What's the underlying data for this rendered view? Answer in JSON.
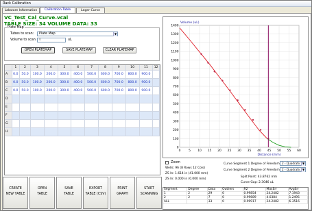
{
  "window": {
    "title": "Rack Calibration"
  },
  "tabs": [
    {
      "label": "Labware Information"
    },
    {
      "label": "Calibration Table"
    },
    {
      "label": "Lager Curve"
    }
  ],
  "file": {
    "name": "VC_Test_Cal_Curve.vcal",
    "summary": "TABLE SIZE: 34   VOLUME DATA: 33"
  },
  "platemap": {
    "group_label": "Plate Map",
    "tubes_label": "Tubes to scan:",
    "tubes_value": "Plate Map",
    "volume_label": "Volume to scan:",
    "volume_value": "0",
    "volume_unit": "uL",
    "open_label": "OPEN PLATEMAP",
    "save_label": "SAVE PLATEMAP",
    "clear_label": "CLEAR PLATEMAP"
  },
  "grid": {
    "columns": [
      "",
      "1",
      "2",
      "3",
      "4",
      "5",
      "6",
      "7",
      "8",
      "9",
      "10",
      "11",
      "12"
    ],
    "rows": [
      {
        "label": "A",
        "cells": [
          "0.0",
          "50.0",
          "100.0",
          "200.0",
          "300.0",
          "400.0",
          "500.0",
          "600.0",
          "700.0",
          "800.0",
          "900.0",
          ""
        ]
      },
      {
        "label": "B",
        "cells": [
          "0.0",
          "50.0",
          "100.0",
          "200.0",
          "300.0",
          "400.0",
          "500.0",
          "600.0",
          "700.0",
          "800.0",
          "900.0",
          ""
        ]
      },
      {
        "label": "C",
        "cells": [
          "0.0",
          "50.0",
          "100.0",
          "200.0",
          "300.0",
          "400.0",
          "500.0",
          "600.0",
          "700.0",
          "800.0",
          "900.0",
          ""
        ]
      },
      {
        "label": "D",
        "cells": [
          "",
          "",
          "",
          "",
          "",
          "",
          "",
          "",
          "",
          "",
          "",
          ""
        ]
      },
      {
        "label": "E",
        "cells": [
          "",
          "",
          "",
          "",
          "",
          "",
          "",
          "",
          "",
          "",
          "",
          ""
        ]
      },
      {
        "label": "F",
        "cells": [
          "",
          "",
          "",
          "",
          "",
          "",
          "",
          "",
          "",
          "",
          "",
          ""
        ]
      },
      {
        "label": "G",
        "cells": [
          "",
          "",
          "",
          "",
          "",
          "",
          "",
          "",
          "",
          "",
          "",
          ""
        ]
      },
      {
        "label": "H",
        "cells": [
          "",
          "",
          "",
          "",
          "",
          "",
          "",
          "",
          "",
          "",
          "",
          ""
        ]
      }
    ]
  },
  "buttons": [
    {
      "line1": "CREATE",
      "line2": "NEW TABLE"
    },
    {
      "line1": "OPEN",
      "line2": "TABLE"
    },
    {
      "line1": "SAVE",
      "line2": "TABLE"
    },
    {
      "line1": "EXPORT",
      "line2": "TABLE (CSV)"
    },
    {
      "line1": "PRINT",
      "line2": "GRAPH"
    },
    {
      "line1": "START",
      "line2": "SCANNING"
    }
  ],
  "chart_data": {
    "type": "line",
    "ylabel": "Volume (uL)",
    "xlabel": "Distance (mm)",
    "xlim": [
      0,
      60
    ],
    "ylim": [
      0,
      1400
    ],
    "xticks": [
      0,
      5,
      10,
      15,
      20,
      25,
      30,
      35,
      40,
      45,
      50,
      55,
      60
    ],
    "yticks": [
      0,
      100,
      200,
      300,
      400,
      500,
      600,
      700,
      800,
      900,
      1000,
      1100,
      1200,
      1300,
      1400
    ],
    "grid": true,
    "series": [
      {
        "color": "#e0202a",
        "x": [
          0,
          5,
          10,
          15,
          20,
          25,
          30,
          35,
          40,
          44
        ],
        "y": [
          1370,
          1235,
          1095,
          955,
          805,
          655,
          500,
          345,
          195,
          100
        ]
      },
      {
        "color": "#20a020",
        "x": [
          44,
          47,
          50,
          53,
          56
        ],
        "y": [
          100,
          55,
          22,
          5,
          0
        ]
      }
    ],
    "markers": {
      "color": "#c03050",
      "x": [
        10.9,
        14.3,
        17.5,
        21.5,
        25.3,
        29.2,
        32.9,
        36.9,
        40.7,
        44.6
      ],
      "y": [
        1070,
        970,
        870,
        765,
        655,
        540,
        430,
        315,
        200,
        100
      ]
    },
    "cursor_x": 44.6,
    "cursor_color": "#8b1060"
  },
  "curve_info": {
    "zoom_label": "Zoom",
    "wells": "Wells: 96 (8 Rows 12 Cols)",
    "zs_in": "ZS In: 1.614 in (41.000 mm)",
    "zs_out": "ZS In: 0.000 in (0.000 mm)",
    "seg1_label": "Curve Segment 1 Degree of Freedom",
    "seg1_value": "2 - Quadratic",
    "seg2_label": "Curve Segment 2 Degree of Freedom",
    "seg2_value": "2 - Quadratic",
    "split_point": "Split Point: 43.8762 mm",
    "curve_gap": "Curve Gap: 2.3046 uL"
  },
  "stats": {
    "headers": [
      "Segment",
      "Degree",
      "Data",
      "Outliers",
      "R2",
      "MaxErr",
      "AvgErr"
    ],
    "rows": [
      [
        "1",
        "2",
        "29",
        "0",
        "0.99854",
        "24.2482",
        "7.1943"
      ],
      [
        "2",
        "2",
        "7",
        "0",
        "0.99689",
        "4.0384",
        "1.2495"
      ],
      [
        "ALL",
        "",
        "33",
        "0",
        "0.99917",
        "24.2482",
        "6.3516"
      ]
    ]
  }
}
